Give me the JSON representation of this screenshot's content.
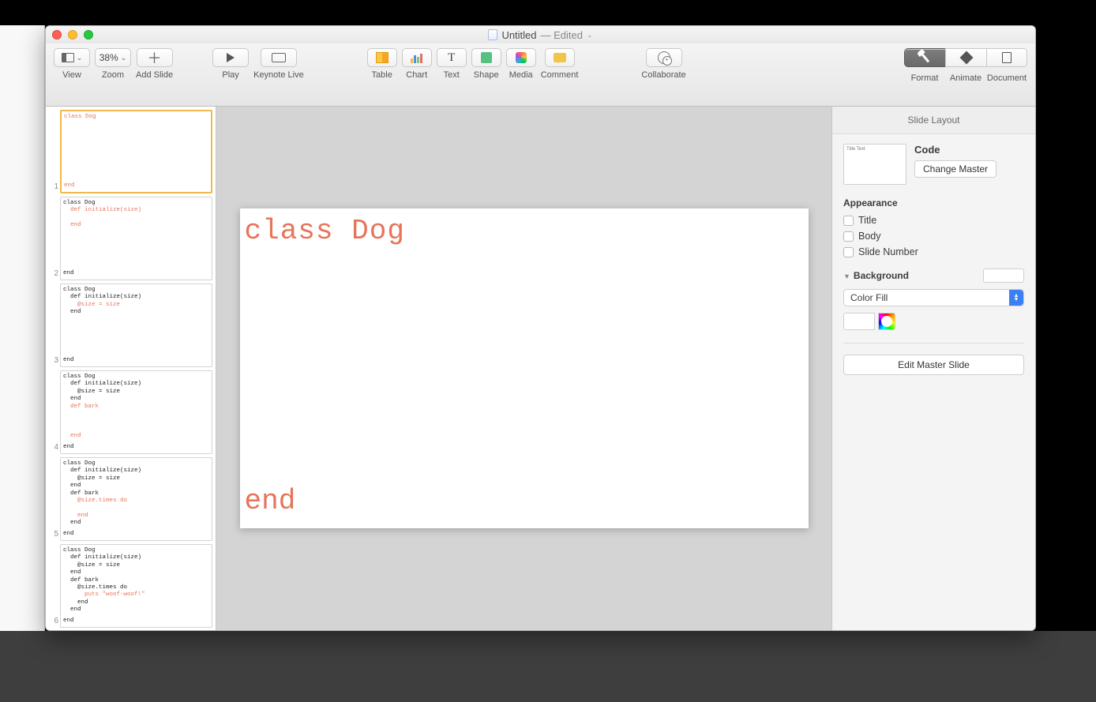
{
  "window": {
    "title": "Untitled",
    "subtitle": "— Edited"
  },
  "toolbar": {
    "view": "View",
    "zoom_value": "38%",
    "zoom": "Zoom",
    "add_slide": "Add Slide",
    "play": "Play",
    "keynote_live": "Keynote Live",
    "table": "Table",
    "chart": "Chart",
    "text": "Text",
    "shape": "Shape",
    "media": "Media",
    "comment": "Comment",
    "collaborate": "Collaborate",
    "format": "Format",
    "animate": "Animate",
    "document": "Document"
  },
  "slides": [
    {
      "n": "1",
      "red_lines": [
        "class Dog"
      ],
      "bottom_red": "end",
      "black_lines": []
    },
    {
      "n": "2",
      "lines": [
        {
          "t": "class Dog",
          "c": "b"
        },
        {
          "t": "  def initialize(size)",
          "c": "r"
        },
        {
          "t": "",
          "c": "b"
        },
        {
          "t": "  end",
          "c": "r"
        }
      ],
      "bottom": {
        "t": "end",
        "c": "b"
      }
    },
    {
      "n": "3",
      "lines": [
        {
          "t": "class Dog",
          "c": "b"
        },
        {
          "t": "  def initialize(size)",
          "c": "b"
        },
        {
          "t": "    @size = size",
          "c": "r"
        },
        {
          "t": "  end",
          "c": "b"
        }
      ],
      "bottom": {
        "t": "end",
        "c": "b"
      }
    },
    {
      "n": "4",
      "lines": [
        {
          "t": "class Dog",
          "c": "b"
        },
        {
          "t": "  def initialize(size)",
          "c": "b"
        },
        {
          "t": "    @size = size",
          "c": "b"
        },
        {
          "t": "  end",
          "c": "b"
        },
        {
          "t": "  def bark",
          "c": "r"
        },
        {
          "t": "",
          "c": "b"
        },
        {
          "t": "",
          "c": "b"
        },
        {
          "t": "",
          "c": "b"
        },
        {
          "t": "  end",
          "c": "r"
        }
      ],
      "bottom": {
        "t": "end",
        "c": "b"
      }
    },
    {
      "n": "5",
      "lines": [
        {
          "t": "class Dog",
          "c": "b"
        },
        {
          "t": "  def initialize(size)",
          "c": "b"
        },
        {
          "t": "    @size = size",
          "c": "b"
        },
        {
          "t": "  end",
          "c": "b"
        },
        {
          "t": "  def bark",
          "c": "b"
        },
        {
          "t": "    @size.times do",
          "c": "r"
        },
        {
          "t": "",
          "c": "b"
        },
        {
          "t": "    end",
          "c": "r"
        },
        {
          "t": "  end",
          "c": "b"
        }
      ],
      "bottom": {
        "t": "end",
        "c": "b"
      }
    },
    {
      "n": "6",
      "lines": [
        {
          "t": "class Dog",
          "c": "b"
        },
        {
          "t": "  def initialize(size)",
          "c": "b"
        },
        {
          "t": "    @size = size",
          "c": "b"
        },
        {
          "t": "  end",
          "c": "b"
        },
        {
          "t": "  def bark",
          "c": "b"
        },
        {
          "t": "    @size.times do",
          "c": "b"
        },
        {
          "t": "      puts \"woof-woof!\"",
          "c": "r"
        },
        {
          "t": "    end",
          "c": "b"
        },
        {
          "t": "  end",
          "c": "b"
        }
      ],
      "bottom": {
        "t": "end",
        "c": "b"
      }
    }
  ],
  "main_slide": {
    "line1": "class Dog",
    "line2": "end"
  },
  "inspector": {
    "header": "Slide Layout",
    "master_thumb_text": "Title Text",
    "master_name": "Code",
    "change_master": "Change Master",
    "appearance": "Appearance",
    "title": "Title",
    "body": "Body",
    "slide_number": "Slide Number",
    "background": "Background",
    "fill_type": "Color Fill",
    "edit_master": "Edit Master Slide"
  }
}
